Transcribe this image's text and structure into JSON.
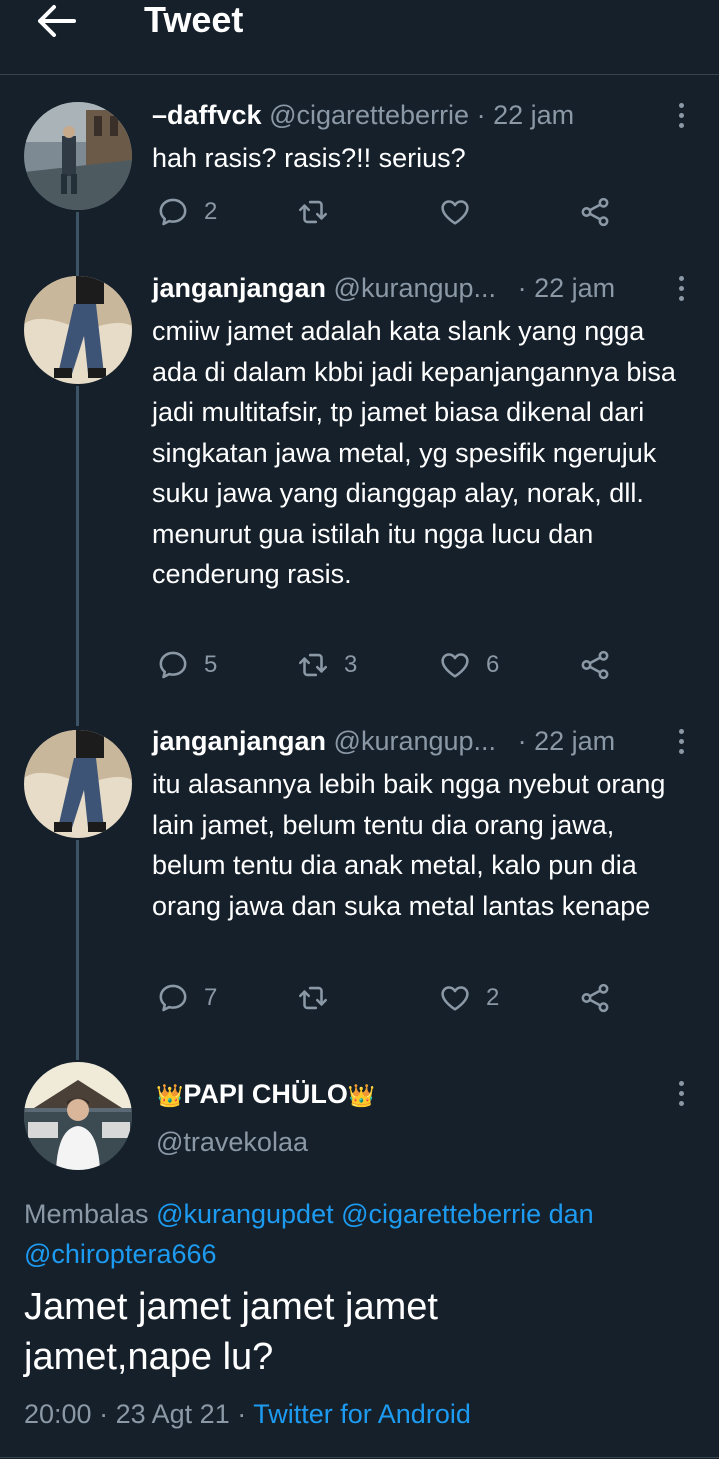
{
  "header": {
    "title": "Tweet",
    "back_icon": "arrow-left-icon"
  },
  "thread": [
    {
      "name": "–daffvck",
      "handle": "@cigaretteberrie",
      "sep": "·",
      "time": "22 jam",
      "text": "hah rasis? rasis?!! serius?",
      "replies": "2",
      "retweets": "",
      "likes": ""
    },
    {
      "name": "janganjangan",
      "handle": "@kurangup...",
      "sep": "·",
      "time": "22 jam",
      "text": "cmiiw jamet adalah kata slank yang ngga ada di dalam kbbi jadi kepanjangannya bisa jadi multitafsir, tp jamet biasa dikenal dari singkatan jawa metal, yg spesifik ngerujuk suku jawa yang dianggap alay, norak, dll. menurut gua istilah itu ngga lucu dan cenderung rasis.",
      "replies": "5",
      "retweets": "3",
      "likes": "6"
    },
    {
      "name": "janganjangan",
      "handle": "@kurangup...",
      "sep": "·",
      "time": "22 jam",
      "text": "itu alasannya lebih baik ngga nyebut orang lain jamet, belum tentu dia orang jawa, belum tentu dia anak metal, kalo pun dia orang jawa dan suka metal lantas kenape",
      "replies": "7",
      "retweets": "",
      "likes": "2"
    }
  ],
  "main_tweet": {
    "name": "PAPI CHÜLO",
    "crown": "👑",
    "handle": "@travekolaa",
    "reply_prefix": "Membalas",
    "reply_to_1": "@kurangupdet",
    "reply_to_2": "@cigaretteberrie",
    "reply_and": "dan",
    "reply_to_3": "@chiroptera666",
    "text": "Jamet jamet jamet jamet jamet,nape lu?",
    "time": "20:00",
    "sep": "·",
    "date": "23 Agt 21",
    "source": "Twitter for Android"
  },
  "colors": {
    "background": "#15202b",
    "muted": "#8b98a5",
    "link": "#1d9bf0",
    "divider": "#38444d",
    "thread_line": "#3d5466"
  },
  "icons": [
    "reply-icon",
    "retweet-icon",
    "like-icon",
    "share-icon",
    "more-icon"
  ]
}
